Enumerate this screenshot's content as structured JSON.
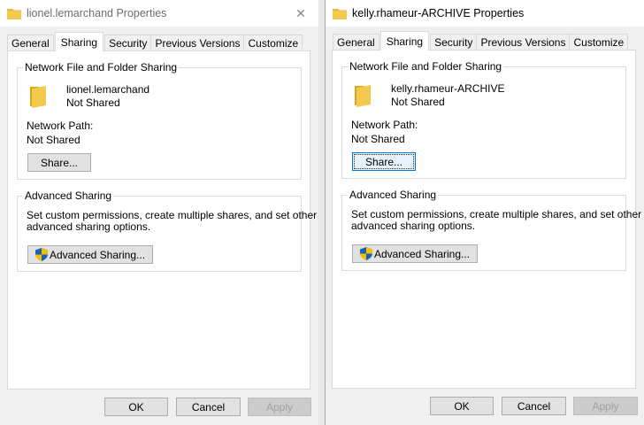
{
  "colors": {
    "folder": "#f0c040",
    "folder_dark": "#d9a520",
    "shield_blue": "#1c5fb8",
    "shield_yellow": "#f2c200"
  },
  "icons": {
    "folder": "folder-icon",
    "close": "close-icon",
    "shield": "uac-shield-icon"
  },
  "windows": [
    {
      "title": "lionel.lemarchand Properties",
      "tabs": [
        "General",
        "Sharing",
        "Security",
        "Previous Versions",
        "Customize"
      ],
      "active_tab": "Sharing",
      "network_group": "Network File and Folder Sharing",
      "folder_name": "lionel.lemarchand",
      "share_status": "Not Shared",
      "network_path_label": "Network Path:",
      "network_path_value": "Not Shared",
      "share_button": "Share...",
      "advanced_group": "Advanced Sharing",
      "advanced_desc_1": "Set custom permissions, create multiple shares, and set other",
      "advanced_desc_2": "advanced sharing options.",
      "advanced_button": "Advanced Sharing...",
      "ok": "OK",
      "cancel": "Cancel",
      "apply": "Apply"
    },
    {
      "title": "kelly.rhameur-ARCHIVE Properties",
      "tabs": [
        "General",
        "Sharing",
        "Security",
        "Previous Versions",
        "Customize"
      ],
      "active_tab": "Sharing",
      "network_group": "Network File and Folder Sharing",
      "folder_name": "kelly.rhameur-ARCHIVE",
      "share_status": "Not Shared",
      "network_path_label": "Network Path:",
      "network_path_value": "Not Shared",
      "share_button": "Share...",
      "advanced_group": "Advanced Sharing",
      "advanced_desc_1": "Set custom permissions, create multiple shares, and set other",
      "advanced_desc_2": "advanced sharing options.",
      "advanced_button": "Advanced Sharing...",
      "ok": "OK",
      "cancel": "Cancel",
      "apply": "Apply"
    }
  ]
}
